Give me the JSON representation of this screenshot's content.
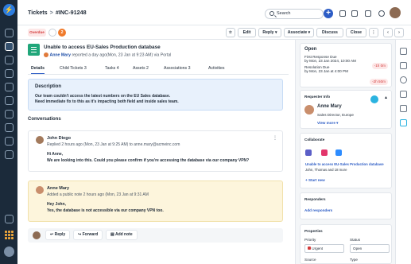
{
  "breadcrumb": {
    "root": "Tickets",
    "separator": ">",
    "ticket_id": "#INC-91248"
  },
  "search": {
    "placeholder": "Search"
  },
  "add_label": "+",
  "toolbar": {
    "overdue": "Overdue",
    "watch_count": "2",
    "edit": "Edit",
    "reply": "Reply",
    "associate": "Associate",
    "discuss": "Discuss",
    "close": "Close",
    "more": "⋮",
    "prev": "‹",
    "next": "›"
  },
  "ticket": {
    "subject": "Unable to access EU-Sales Production database",
    "requester": "Anne Mary",
    "reported_text": "reported a day ago(Mon, 23 Jan at 9:23 AM) via Portal",
    "tabs": [
      "Details",
      "Child Tickets 3",
      "Tasks 4",
      "Assets 2",
      "Associations 3",
      "Activities"
    ],
    "description": {
      "heading": "Description",
      "line1": "Our team couldn't access the latest numbers on the EU Sales database.",
      "line2": "Need immediate fix to this as it's impacting both field and inside sales team."
    }
  },
  "conversations": {
    "heading": "Conversations",
    "items": [
      {
        "author": "John Diego",
        "line": "Replied 2 hours ago (Mon, 23 Jan at 9:25 AM) to anne.mary@acmeinc.com",
        "body1": "Hi Anne,",
        "body2": "We are looking into this. Could you please confirm if you're accessing the database via our company VPN?"
      },
      {
        "author": "Anne Mary",
        "line": "Added a public note 2 hours ago (Mon, 23 Jan at 9:31 AM",
        "body1": "Hey John,",
        "body2": "Yes, the database is not accessible via our company VPN too."
      }
    ]
  },
  "reply_bar": {
    "reply": "Reply",
    "forward": "Forward",
    "add_note": "Add note"
  },
  "sidebar": {
    "status": "Open",
    "first_response_label": "First Response Due",
    "first_response_value": "by Mon, 23 Jan 2024, 10:00 AM",
    "first_response_badge": "-1h 0m",
    "resolution_label": "Resolution Due",
    "resolution_value": "by Mon, 23 Jan at 4:00 PM",
    "resolution_badge": "-2h 50m",
    "requester_heading": "Requester Info",
    "requester_name": "Anne Mary",
    "requester_title": "Sales Director, Europe",
    "view_more": "View more",
    "collaborate_heading": "Collaborate",
    "collab_link": "Unable to access EU-Sales Production database",
    "collab_people": "John, Thomas and 18 more",
    "start_new": "Start new",
    "responders_heading": "Responders",
    "add_responders": "Add responders",
    "properties_heading": "Properties",
    "priority_label": "Priority",
    "priority_value": "Urgent",
    "status_label": "Status",
    "status_value": "Open",
    "source_label": "Source",
    "type_label": "Type"
  },
  "colors": {
    "nav": "#1b2a3a",
    "accent": "#2c5cc5",
    "ticket_icon": "#21a67a",
    "overdue": "#d33a3a",
    "urgent": "#d33a3a"
  }
}
